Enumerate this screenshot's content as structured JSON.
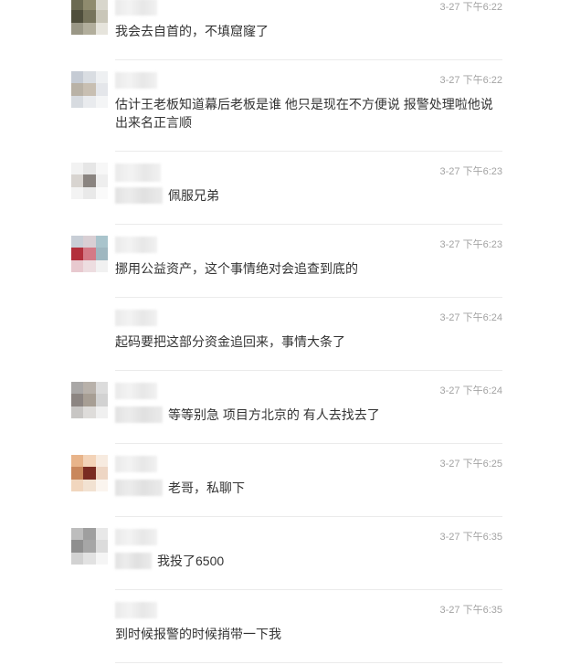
{
  "comments": [
    {
      "time": "3-27 下午6:22",
      "text": "我会去自首的，不填窟窿了",
      "avatar": [
        "#6b6a52",
        "#8f8b6e",
        "#d8d6cc",
        "#4f4e3c",
        "#77745c",
        "#c9c6b8",
        "#9a9786",
        "#b2ae9c",
        "#e6e4dc"
      ]
    },
    {
      "time": "3-27 下午6:22",
      "text": "估计王老板知道幕后老板是谁 他只是现在不方便说 报警处理啦他说出来名正言顺",
      "avatar": [
        "#c5cbd4",
        "#d9dde2",
        "#eef0f2",
        "#b9b2a6",
        "#c8bfb2",
        "#e4e6ea",
        "#d7dbe0",
        "#e9ebee",
        "#f4f5f6"
      ]
    },
    {
      "time": "3-27 下午6:23",
      "text": "佩服兄弟",
      "avatar": [
        "#f2f2f2",
        "#e6e6e6",
        "#f7f7f7",
        "#d8d4d0",
        "#8a8480",
        "#eeeeee",
        "#f3f3f3",
        "#e9e9e9",
        "#fafafa"
      ]
    },
    {
      "time": "3-27 下午6:23",
      "text": "挪用公益资产，这个事情绝对会追查到底的",
      "avatar": [
        "#c8ced6",
        "#d9cfd4",
        "#a9c4cc",
        "#b3303c",
        "#d47a86",
        "#9fb7c0",
        "#e8c9cf",
        "#eddde0",
        "#f1f1f1"
      ]
    },
    {
      "time": "3-27 下午6:24",
      "text": "起码要把这部分资金追回来，事情大条了",
      "avatar": []
    },
    {
      "time": "3-27 下午6:24",
      "text": "等等别急 项目方北京的 有人去找去了",
      "avatar": [
        "#a9a7a6",
        "#b8b1aa",
        "#dcdcdc",
        "#8c8582",
        "#a79e94",
        "#d2d2d2",
        "#c8c6c4",
        "#dedcda",
        "#f0f0f0"
      ]
    },
    {
      "time": "3-27 下午6:25",
      "text": "老哥，私聊下",
      "avatar": [
        "#e8b48a",
        "#f3d3b8",
        "#f7ebe0",
        "#c9875c",
        "#7a2b22",
        "#eed6c4",
        "#f1d6be",
        "#f2e2d2",
        "#fbf5ef"
      ]
    },
    {
      "time": "3-27 下午6:35",
      "text": "我投了6500",
      "avatar": [
        "#bdbdbd",
        "#9f9f9f",
        "#e8e8e8",
        "#8f8f8f",
        "#a6a6a6",
        "#dcdcdc",
        "#d2d2d2",
        "#e2e2e2",
        "#f5f5f5"
      ]
    },
    {
      "time": "3-27 下午6:35",
      "text": "到时候报警的时候捎带一下我",
      "avatar": []
    }
  ]
}
